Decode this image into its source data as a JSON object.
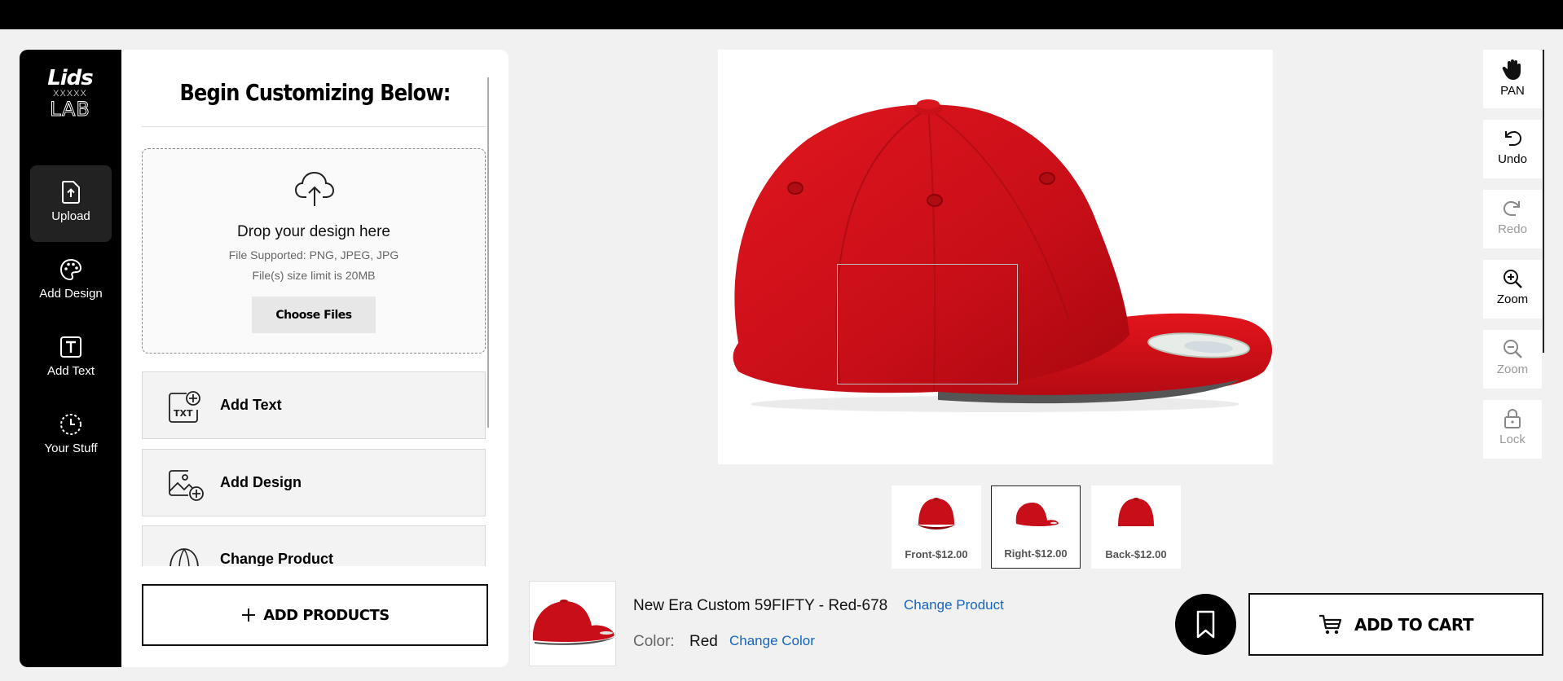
{
  "brand": {
    "name": "Lids",
    "sub": "LAB",
    "pattern": "XXXXX"
  },
  "rail": [
    {
      "label": "Upload",
      "icon": "upload-file-icon",
      "active": true
    },
    {
      "label": "Add Design",
      "icon": "palette-icon",
      "active": false
    },
    {
      "label": "Add Text",
      "icon": "text-box-icon",
      "active": false
    },
    {
      "label": "Your Stuff",
      "icon": "clock-icon",
      "active": false
    }
  ],
  "panel": {
    "heading": "Begin Customizing Below:",
    "dropzone": {
      "title": "Drop your design here",
      "supported": "File Supported: PNG, JPEG, JPG",
      "limit": "File(s) size limit is 20MB",
      "button": "Choose Files"
    },
    "actions": [
      {
        "label": "Add Text",
        "icon": "add-text-icon"
      },
      {
        "label": "Add Design",
        "icon": "add-image-icon"
      },
      {
        "label": "Change Product",
        "icon": "cap-icon"
      }
    ],
    "add_products": "ADD PRODUCTS",
    "txt_icon_label": "TXT"
  },
  "views": [
    {
      "label": "Front-$12.00",
      "selected": false
    },
    {
      "label": "Right-$12.00",
      "selected": true
    },
    {
      "label": "Back-$12.00",
      "selected": false
    }
  ],
  "tools": [
    {
      "label": "PAN",
      "icon": "hand-icon",
      "enabled": true
    },
    {
      "label": "Undo",
      "icon": "undo-icon",
      "enabled": true
    },
    {
      "label": "Redo",
      "icon": "redo-icon",
      "enabled": false
    },
    {
      "label": "Zoom",
      "icon": "zoom-in-icon",
      "enabled": true
    },
    {
      "label": "Zoom",
      "icon": "zoom-out-icon",
      "enabled": false
    },
    {
      "label": "Lock",
      "icon": "lock-icon",
      "enabled": false
    }
  ],
  "product": {
    "name": "New Era Custom 59FIFTY - Red-678",
    "change_product": "Change Product",
    "color_label": "Color:",
    "color_value": "Red",
    "change_color": "Change Color"
  },
  "cart": {
    "label": "ADD TO CART"
  },
  "colors": {
    "cap_red": "#d2111b",
    "link_blue": "#1565c0"
  }
}
